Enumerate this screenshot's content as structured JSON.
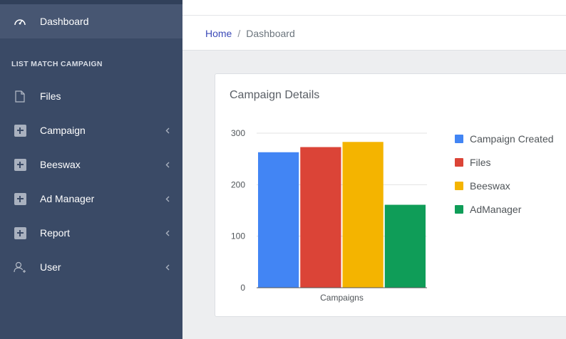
{
  "sidebar": {
    "dashboard": "Dashboard",
    "section_title": "LIST MATCH CAMPAIGN",
    "items": [
      {
        "label": "Files",
        "icon": "file-icon",
        "chevron": false
      },
      {
        "label": "Campaign",
        "icon": "plus-square-icon",
        "chevron": true
      },
      {
        "label": "Beeswax",
        "icon": "plus-square-icon",
        "chevron": true
      },
      {
        "label": "Ad Manager",
        "icon": "plus-square-icon",
        "chevron": true
      },
      {
        "label": "Report",
        "icon": "plus-square-icon",
        "chevron": true
      },
      {
        "label": "User",
        "icon": "user-add-icon",
        "chevron": true
      }
    ],
    "colors": {
      "background": "#3a4a66",
      "active": "#475672"
    }
  },
  "breadcrumb": {
    "home": "Home",
    "separator": "/",
    "current": "Dashboard"
  },
  "card": {
    "title": "Campaign Details"
  },
  "chart_data": {
    "type": "bar",
    "categories": [
      "Campaigns"
    ],
    "series": [
      {
        "name": "Campaign Created",
        "values": [
          263
        ],
        "color": "#4285f4"
      },
      {
        "name": "Files",
        "values": [
          273
        ],
        "color": "#db4437"
      },
      {
        "name": "Beeswax",
        "values": [
          283
        ],
        "color": "#f4b400"
      },
      {
        "name": "AdManager",
        "values": [
          161
        ],
        "color": "#0f9d58"
      }
    ],
    "yticks": [
      "0",
      "100",
      "200",
      "300"
    ],
    "ylim": [
      0,
      300
    ],
    "grid": true,
    "legend": "right",
    "xlabel": "",
    "ylabel": "",
    "title": ""
  }
}
